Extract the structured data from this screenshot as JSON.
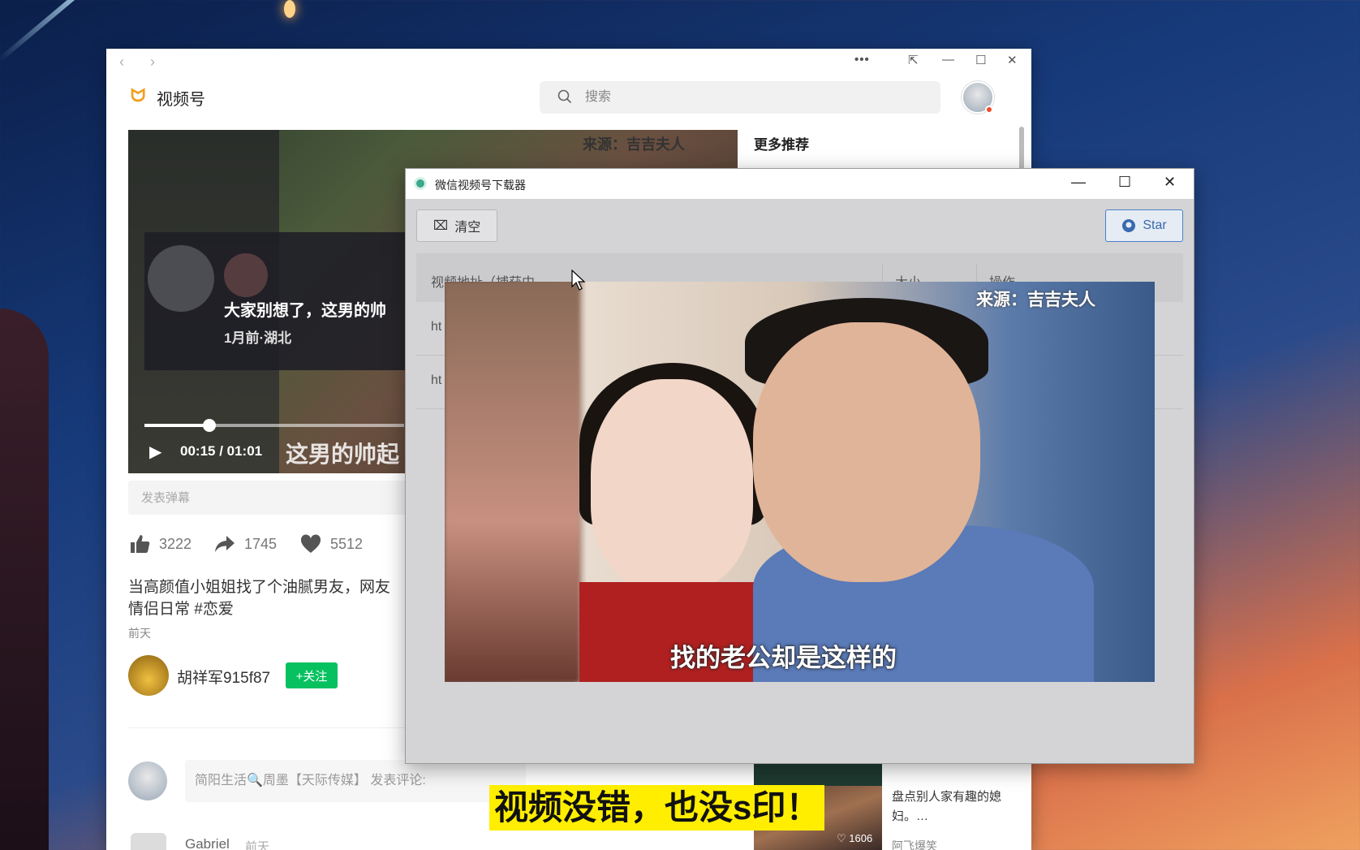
{
  "main_window": {
    "app_title": "视频号",
    "search": {
      "placeholder": "搜索"
    },
    "video": {
      "source_watermark": "来源：吉吉夫人",
      "card_title": "大家别想了，这男的帅",
      "card_meta": "1月前·湖北",
      "time": "00:15 / 01:01",
      "progress": 0.25,
      "subtitle": "这男的帅起"
    },
    "danmaku": {
      "placeholder": "发表弹幕"
    },
    "actions": {
      "likes": "3222",
      "shares": "1745",
      "favorites": "5512"
    },
    "post": {
      "description_line1": "当高颜值小姐姐找了个油腻男友，网友",
      "description_line2": "情侣日常 #恋爱",
      "time": "前天"
    },
    "author": {
      "name": "胡祥军915f87",
      "follow_label": "+关注"
    },
    "comment_box": {
      "placeholder": "简阳生活🔍周墨【天际传媒】 发表评论:"
    },
    "comments": [
      {
        "user": "Gabriel",
        "time": "前天"
      }
    ],
    "sidebar": {
      "heading": "更多推荐",
      "recommendation": {
        "title": "盘点别人家有趣的媳妇。…",
        "author": "阿飞爆笑",
        "likes": "♡ 1606"
      }
    }
  },
  "downloader": {
    "title": "微信视频号下载器",
    "clear_label": "清空",
    "star_label": "Star",
    "columns": [
      "视频地址（捕获中",
      "大小",
      "操作"
    ],
    "rows": [
      {
        "url": "ht"
      },
      {
        "url": "ht"
      }
    ],
    "preview": {
      "source_watermark": "来源：吉吉夫人",
      "subtitle": "找的老公却是这样的"
    }
  },
  "caption": "视频没错，也没s印！",
  "colors": {
    "accent_green": "#07c160",
    "caption_yellow": "#ffee00",
    "star_blue": "#4a80c8"
  }
}
